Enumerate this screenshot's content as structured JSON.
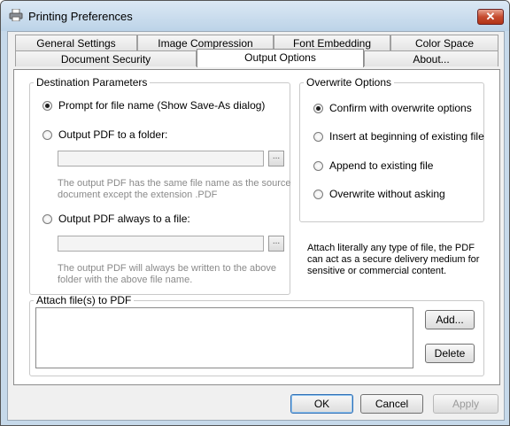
{
  "window": {
    "title": "Printing Preferences",
    "close_glyph": "✕"
  },
  "tabs_row1": [
    "General Settings",
    "Image Compression",
    "Font Embedding",
    "Color Space"
  ],
  "tabs_row2": [
    "Document Security",
    "Output Options",
    "About..."
  ],
  "active_tab": "Output Options",
  "destination": {
    "legend": "Destination Parameters",
    "prompt_label": "Prompt for file name (Show Save-As dialog)",
    "folder_label": "Output PDF to a folder:",
    "folder_value": "",
    "folder_browse": "...",
    "folder_hint_1": "The output PDF has the same file name as the source",
    "folder_hint_2": "document except the extension .PDF",
    "file_label": "Output PDF always to a file:",
    "file_value": "",
    "file_browse": "...",
    "file_hint_1": "The output PDF will always be written to the above",
    "file_hint_2": "folder with the above file name.",
    "selected": "prompt"
  },
  "overwrite": {
    "legend": "Overwrite Options",
    "options": [
      "Confirm with overwrite options",
      "Insert at beginning of existing file",
      "Append to existing file",
      "Overwrite without asking"
    ],
    "selected_index": 0
  },
  "attach_note": {
    "line1": "Attach literally any type of file, the PDF",
    "line2": "can act as a secure delivery medium for",
    "line3": "sensitive or commercial content."
  },
  "attach": {
    "legend": "Attach file(s) to PDF",
    "add_label": "Add...",
    "delete_label": "Delete"
  },
  "footer": {
    "ok_label": "OK",
    "cancel_label": "Cancel",
    "apply_label": "Apply"
  }
}
